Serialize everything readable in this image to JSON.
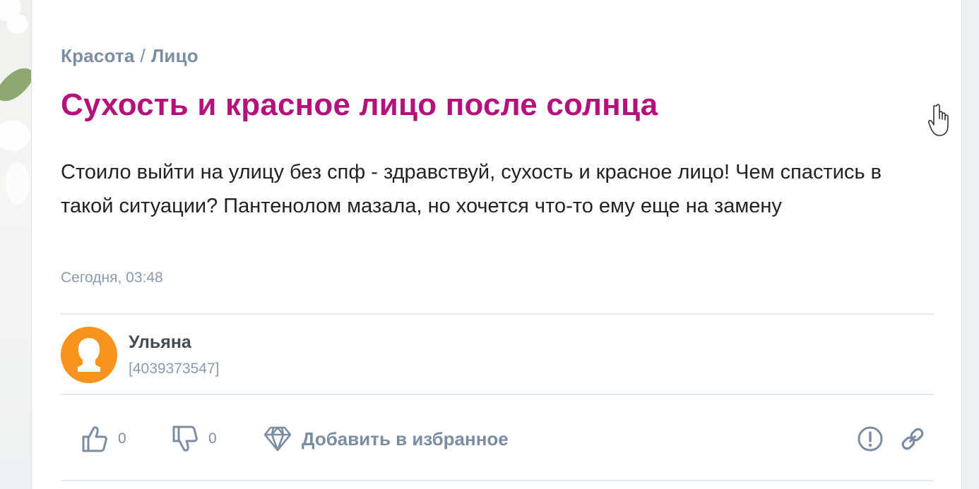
{
  "breadcrumb": {
    "section": "Красота",
    "separator": "/",
    "subsection": "Лицо"
  },
  "question": {
    "title": "Сухость и красное лицо после солнца",
    "body": "Стоило выйти на улицу без спф - здравствуй, сухость и красное лицо! Чем спастись в такой ситуации? Пантенолом мазала, но хочется что-то ему еще на замену",
    "timestamp": "Сегодня, 03:48"
  },
  "author": {
    "name": "Ульяна",
    "id": "[4039373547]",
    "avatar_color": "#f7941d"
  },
  "actions": {
    "likes": "0",
    "dislikes": "0",
    "favorite_label": "Добавить в избранное"
  },
  "colors": {
    "title": "#b5117a",
    "muted": "#7b8da3",
    "text": "#222222"
  },
  "icons": [
    "thumbs-up-icon",
    "thumbs-down-icon",
    "diamond-icon",
    "report-icon",
    "link-icon",
    "hand-cursor-icon"
  ]
}
